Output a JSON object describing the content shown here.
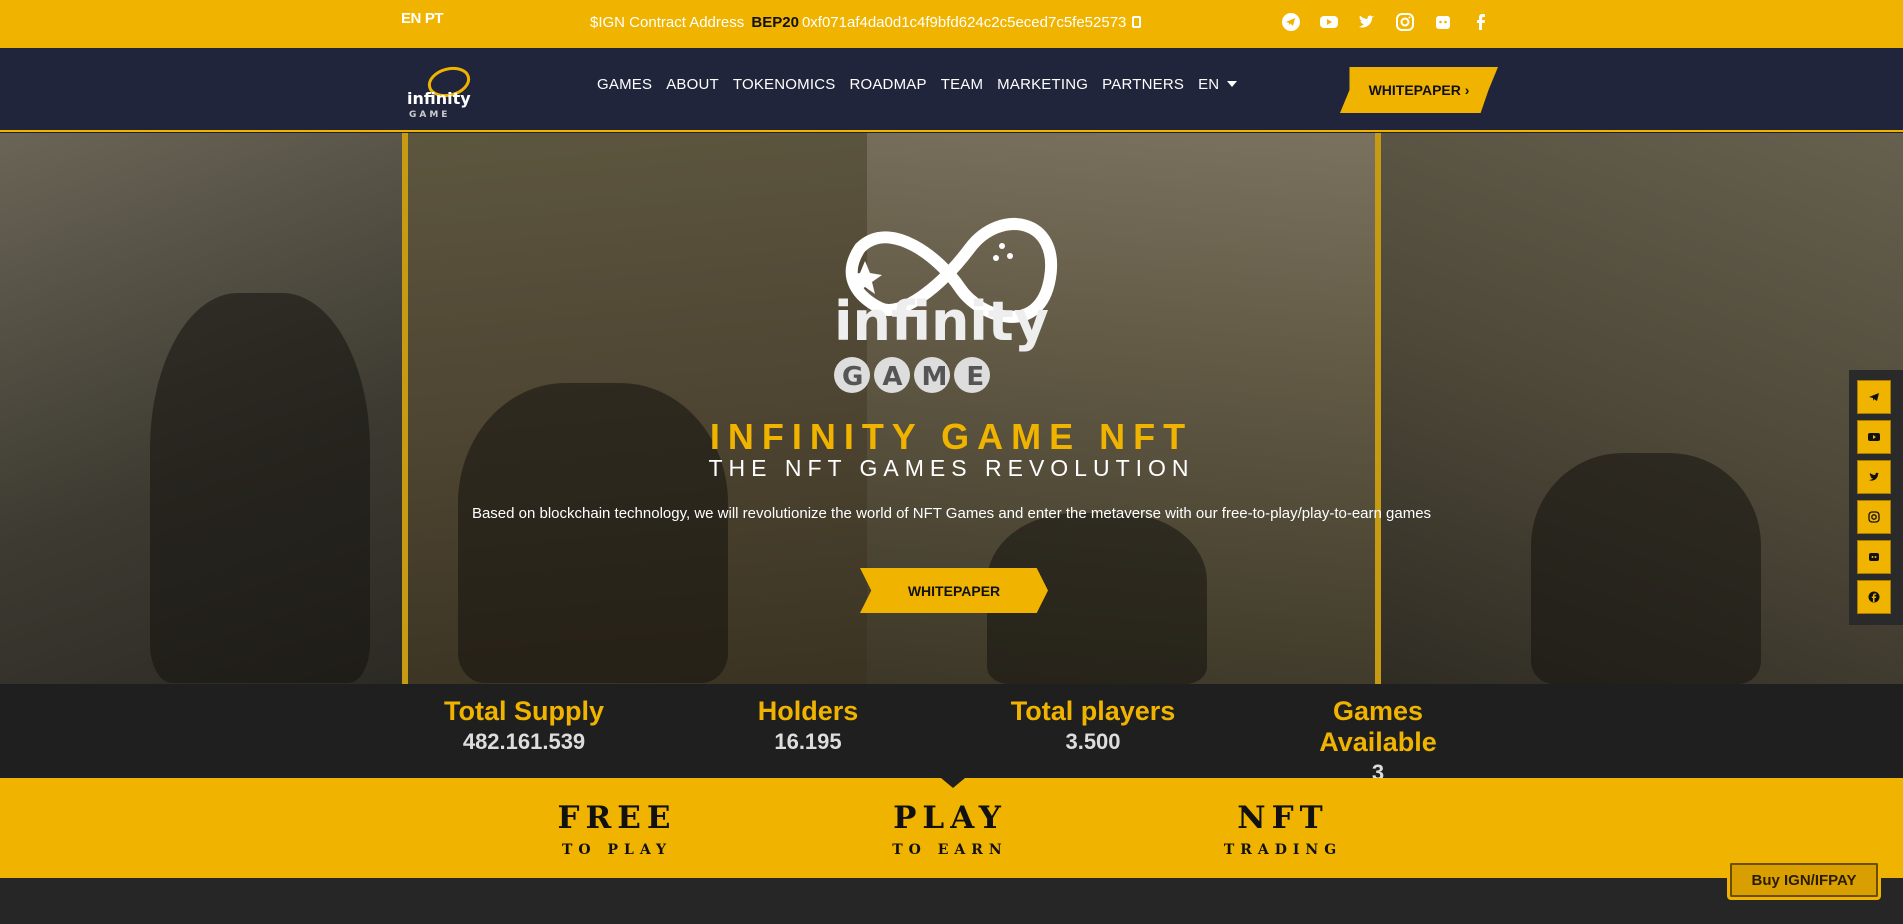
{
  "topbar": {
    "lang_en": "EN",
    "lang_pt": "PT",
    "contract_label": "$IGN Contract Address",
    "contract_network": "BEP20",
    "contract_address": "0xf071af4da0d1c4f9bfd624c2c5eced7c5fe52573",
    "socials": [
      "telegram-icon",
      "youtube-icon",
      "twitter-icon",
      "instagram-icon",
      "discord-icon",
      "facebook-icon"
    ]
  },
  "nav": {
    "logo_text": "infinity",
    "logo_sub": "GAME",
    "items": [
      "GAMES",
      "ABOUT",
      "TOKENOMICS",
      "ROADMAP",
      "TEAM",
      "MARKETING",
      "PARTNERS",
      "EN"
    ],
    "whitepaper": "WHITEPAPER ›"
  },
  "hero": {
    "logo_text": "infinity",
    "logo_sub": "GAME",
    "title": "INFINITY GAME NFT",
    "subtitle": "THE NFT GAMES REVOLUTION",
    "description": "Based on blockchain technology, we will revolutionize the world of NFT Games and enter the metaverse with our free-to-play/play-to-earn games",
    "button": "WHITEPAPER"
  },
  "stats": [
    {
      "label": "Total Supply",
      "value": "482.161.539"
    },
    {
      "label": "Holders",
      "value": "16.195"
    },
    {
      "label": "Total players",
      "value": "3.500"
    },
    {
      "label": "Games Available",
      "value": "3"
    }
  ],
  "features": [
    {
      "big": "FREE",
      "small": "TO PLAY"
    },
    {
      "big": "PLAY",
      "small": "TO EARN"
    },
    {
      "big": "NFT",
      "small": "TRADING"
    }
  ],
  "buy_button": "Buy IGN/IFPAY",
  "colors": {
    "accent": "#f0b400",
    "nav_bg": "#21253c"
  }
}
